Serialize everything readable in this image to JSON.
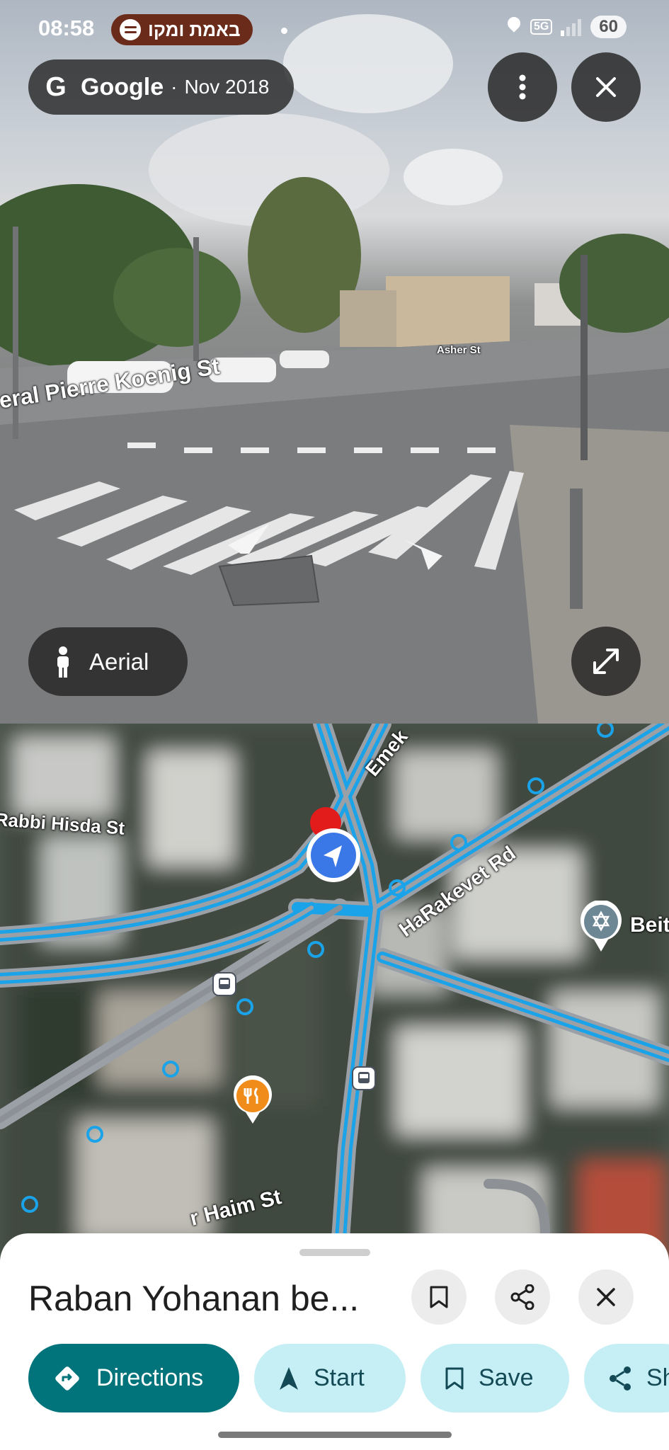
{
  "status_bar": {
    "time": "08:58",
    "media_text": "באמת ומקו",
    "network": "5G",
    "battery": "60"
  },
  "street_view": {
    "brand": "Google",
    "separator": "·",
    "capture_date": "Nov 2018",
    "aerial_label": "Aerial",
    "street_labels": {
      "main": "eral Pierre Koenig St",
      "side": "Asher St"
    }
  },
  "map": {
    "labels": {
      "emek": "Emek",
      "rabbi_hisda": "Rabbi Hisda St",
      "harakevet": "HaRakevet Rd",
      "beit": "Beit",
      "haim": "r Haim St"
    }
  },
  "place_sheet": {
    "title": "Raban Yohanan be...",
    "actions": {
      "directions": "Directions",
      "start": "Start",
      "save": "Save",
      "share": "Sh"
    }
  },
  "colors": {
    "directions_bg": "#00747a",
    "chip_bg": "#c6eff5",
    "road_highlight": "#1aa3e8"
  }
}
